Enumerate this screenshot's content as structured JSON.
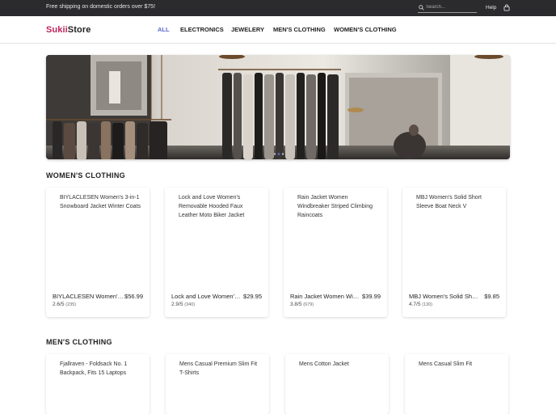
{
  "topbar": {
    "promo": "Free shipping on domestic orders over $75!",
    "search_placeholder": "Search...",
    "help": "Help",
    "icons": [
      "search-icon",
      "shopping-bag-icon"
    ]
  },
  "brand": {
    "part1": "Sukii",
    "part2": "Store",
    "accent": "#c0245c"
  },
  "nav": {
    "active_color": "#5b6ad0",
    "items": [
      {
        "label": "ALL",
        "active": true
      },
      {
        "label": "ELECTRONICS",
        "active": false
      },
      {
        "label": "JEWELERY",
        "active": false
      },
      {
        "label": "MEN'S CLOTHING",
        "active": false
      },
      {
        "label": "WOMEN'S CLOTHING",
        "active": false
      }
    ]
  },
  "hero": {
    "slides": 3,
    "active_slide": 1
  },
  "sections": [
    {
      "title": "WOMEN'S CLOTHING",
      "products": [
        {
          "image_alt": "BIYLACLESEN Women's 3-in-1 Snowboard Jacket Winter Coats",
          "title": "BIYLACLESEN Women's 3-in-1 Snowboard Jacket Winter Coats",
          "price": "$56.99",
          "rating": "2.6/5",
          "count": "(235)"
        },
        {
          "image_alt": "Lock and Love Women's Removable Hooded Faux Leather Moto Biker Jacket",
          "title": "Lock and Love Women's Removable Hooded Faux Leather Moto Biker Jacket",
          "price": "$29.95",
          "rating": "2.9/5",
          "count": "(340)"
        },
        {
          "image_alt": "Rain Jacket Women Windbreaker Striped Climbing Raincoats",
          "title": "Rain Jacket Women Windbreaker Striped Climbing Raincoats",
          "price": "$39.99",
          "rating": "3.8/5",
          "count": "(679)"
        },
        {
          "image_alt": "MBJ Women's Solid Short Sleeve Boat Neck V",
          "title": "MBJ Women's Solid Short Sleeve Boat Neck V",
          "price": "$9.85",
          "rating": "4.7/5",
          "count": "(130)"
        }
      ]
    },
    {
      "title": "MEN'S CLOTHING",
      "products": [
        {
          "image_alt": "Fjallraven - Foldsack No. 1 Backpack, Fits 15 Laptops"
        },
        {
          "image_alt": "Mens Casual Premium Slim Fit T-Shirts"
        },
        {
          "image_alt": "Mens Cotton Jacket"
        },
        {
          "image_alt": "Mens Casual Slim Fit"
        }
      ]
    }
  ]
}
